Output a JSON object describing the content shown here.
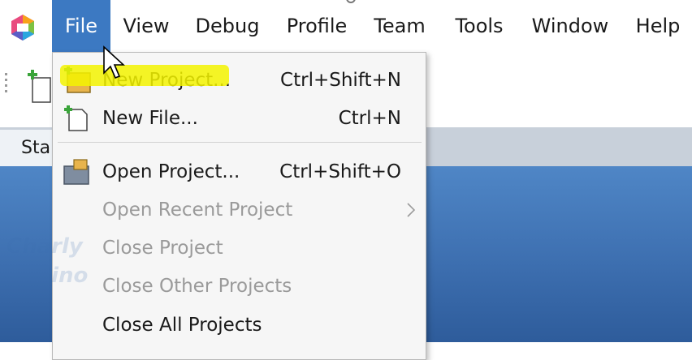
{
  "menubar": {
    "items": [
      {
        "label": "File",
        "active": true
      },
      {
        "label": "View"
      },
      {
        "label": "Debug"
      },
      {
        "label": "Profile"
      },
      {
        "label": "Team"
      },
      {
        "label": "Tools"
      },
      {
        "label": "Window"
      },
      {
        "label": "Help"
      }
    ]
  },
  "tabs": [
    {
      "label": "Sta"
    }
  ],
  "file_menu": {
    "items": [
      {
        "label": "New Project...",
        "shortcut": "Ctrl+Shift+N",
        "icon": "new-project-icon",
        "enabled": true
      },
      {
        "label": "New File...",
        "shortcut": "Ctrl+N",
        "icon": "new-file-icon",
        "enabled": true
      },
      {
        "label": "Open Project...",
        "shortcut": "Ctrl+Shift+O",
        "icon": "open-project-icon",
        "enabled": true
      },
      {
        "label": "Open Recent Project",
        "shortcut": "",
        "icon": "",
        "enabled": false,
        "submenu": true
      },
      {
        "label": "Close Project",
        "shortcut": "",
        "icon": "",
        "enabled": false
      },
      {
        "label": "Close Other Projects",
        "shortcut": "",
        "icon": "",
        "enabled": false
      },
      {
        "label": "Close All Projects",
        "shortcut": "",
        "icon": "",
        "enabled": true
      }
    ]
  },
  "watermark": {
    "text": "Charly Cimino"
  },
  "colors": {
    "active_menu": "#3c79c2",
    "highlight": "#f3f300",
    "content_bg": "#3d6fb0",
    "disabled_text": "#9a9a9a"
  }
}
